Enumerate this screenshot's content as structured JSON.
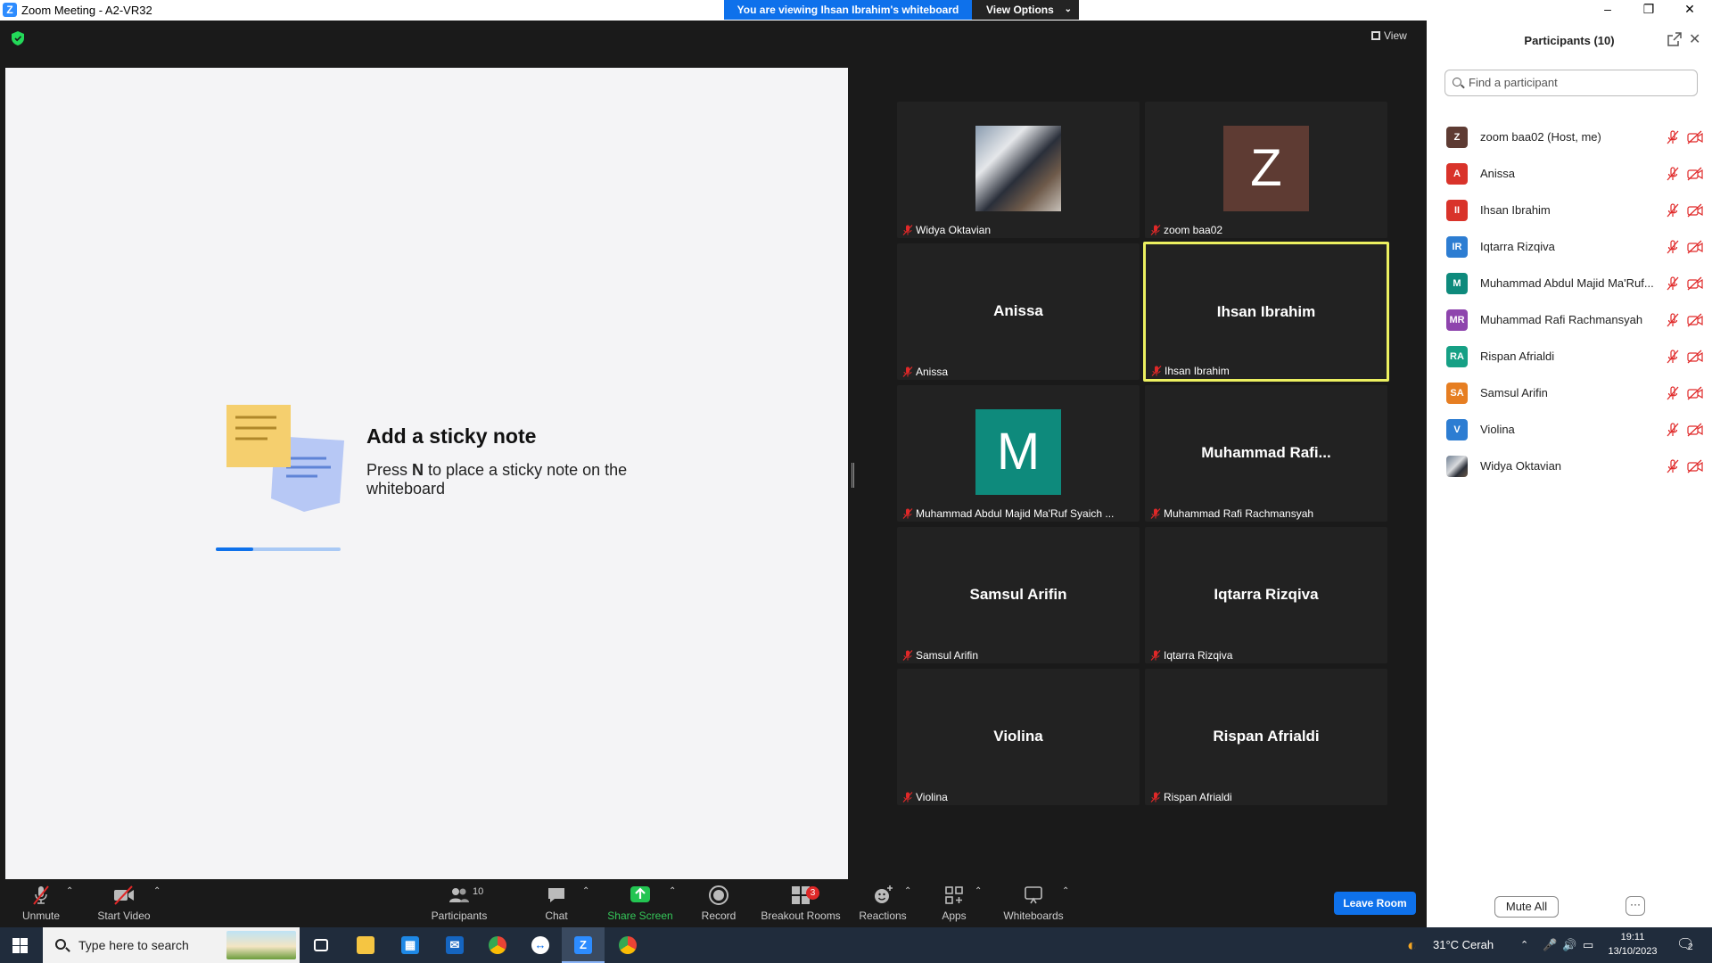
{
  "window": {
    "title": "Zoom Meeting - A2-VR32",
    "banner": "You are viewing Ihsan Ibrahim's whiteboard",
    "view_options": "View Options",
    "view_label": "View"
  },
  "whiteboard": {
    "title": "Add a sticky note",
    "desc_pre": "Press ",
    "desc_key": "N",
    "desc_post": " to place a sticky note on the whiteboard",
    "progress": 0.3
  },
  "tiles": [
    {
      "center": "",
      "label": "Widya Oktavian",
      "kind": "photo"
    },
    {
      "center": "",
      "label": "zoom baa02",
      "kind": "avatar",
      "letter": "Z",
      "color": "#5e3b33"
    },
    {
      "center": "Anissa",
      "label": "Anissa",
      "kind": "name"
    },
    {
      "center": "Ihsan Ibrahim",
      "label": "Ihsan Ibrahim",
      "kind": "name",
      "active": true
    },
    {
      "center": "",
      "label": "Muhammad Abdul Majid Ma'Ruf Syaich ...",
      "kind": "avatar",
      "letter": "M",
      "color": "#0e8a7c"
    },
    {
      "center": "Muhammad  Rafi...",
      "label": "Muhammad Rafi Rachmansyah",
      "kind": "name"
    },
    {
      "center": "Samsul Arifin",
      "label": "Samsul Arifin",
      "kind": "name"
    },
    {
      "center": "Iqtarra Rizqiva",
      "label": "Iqtarra Rizqiva",
      "kind": "name"
    },
    {
      "center": "Violina",
      "label": "Violina",
      "kind": "name"
    },
    {
      "center": "Rispan Afrialdi",
      "label": "Rispan Afrialdi",
      "kind": "name"
    }
  ],
  "panel": {
    "title": "Participants (10)",
    "search_placeholder": "Find a participant",
    "participants": [
      {
        "initials": "Z",
        "name": "zoom baa02 (Host, me)",
        "color": "#5e3b33"
      },
      {
        "initials": "A",
        "name": "Anissa",
        "color": "#d9332a"
      },
      {
        "initials": "II",
        "name": "Ihsan Ibrahim",
        "color": "#d9332a"
      },
      {
        "initials": "IR",
        "name": "Iqtarra Rizqiva",
        "color": "#2d7dd2"
      },
      {
        "initials": "M",
        "name": "Muhammad Abdul Majid Ma'Ruf...",
        "color": "#0e8a7c"
      },
      {
        "initials": "MR",
        "name": "Muhammad Rafi Rachmansyah",
        "color": "#8e44ad"
      },
      {
        "initials": "RA",
        "name": "Rispan Afrialdi",
        "color": "#16a085"
      },
      {
        "initials": "SA",
        "name": "Samsul Arifin",
        "color": "#e67e22"
      },
      {
        "initials": "V",
        "name": "Violina",
        "color": "#2d7dd2"
      },
      {
        "initials": "",
        "name": "Widya Oktavian",
        "color": "",
        "photo": true
      }
    ],
    "mute_all": "Mute All",
    "more": "···"
  },
  "toolbar": {
    "unmute": "Unmute",
    "start_video": "Start Video",
    "participants": "Participants",
    "participants_count": "10",
    "chat": "Chat",
    "share_screen": "Share Screen",
    "record": "Record",
    "breakout": "Breakout Rooms",
    "breakout_badge": "3",
    "reactions": "Reactions",
    "apps": "Apps",
    "whiteboards": "Whiteboards",
    "leave": "Leave Room"
  },
  "taskbar": {
    "search_placeholder": "Type here to search",
    "weather": "31°C  Cerah",
    "time": "19:11",
    "date": "13/10/2023",
    "notif_count": "2"
  },
  "colors": {
    "accent": "#0e71eb",
    "active_border": "#ecf060",
    "mute_red": "#e02828",
    "share_green": "#35c759"
  }
}
